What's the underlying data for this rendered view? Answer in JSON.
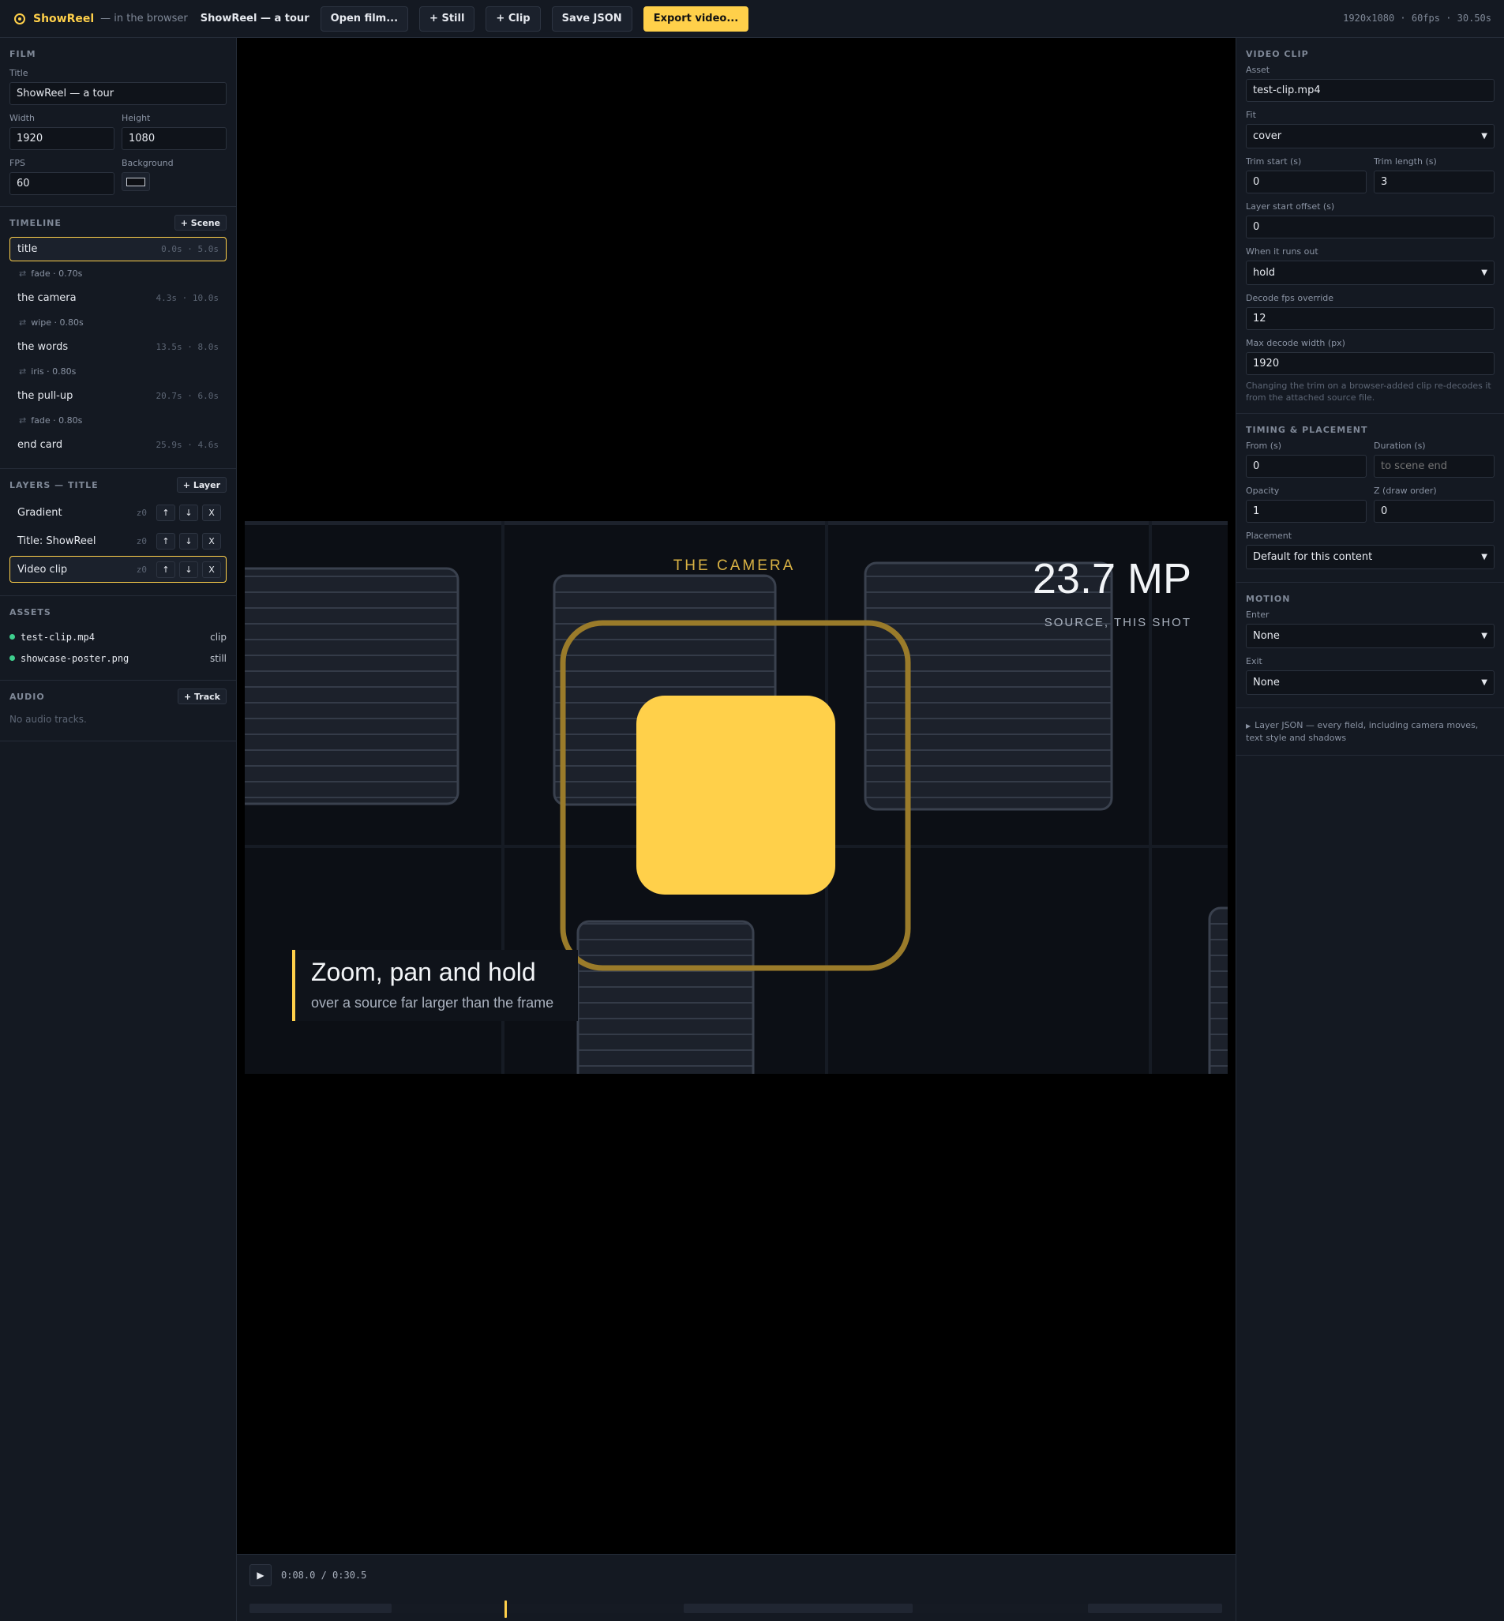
{
  "topbar": {
    "brand": "ShowReel",
    "brand_sub": "— in the browser",
    "film_name": "ShowReel — a tour",
    "buttons": {
      "open_film": "Open film...",
      "add_still": "+ Still",
      "add_clip": "+ Clip",
      "save_json": "Save JSON",
      "export_video": "Export video..."
    },
    "stats": "1920x1080 · 60fps · 30.50s",
    "accent_color": "#ffd04a"
  },
  "film": {
    "section_title": "FILM",
    "title_label": "Title",
    "title_value": "ShowReel — a tour",
    "width_label": "Width",
    "width_value": "1920",
    "height_label": "Height",
    "height_value": "1080",
    "fps_label": "FPS",
    "fps_value": "60",
    "background_label": "Background"
  },
  "timeline": {
    "section_title": "TIMELINE",
    "add_button": "+ Scene",
    "scenes": [
      {
        "name": "title",
        "time": "0.0s · 5.0s",
        "transition": "fade · 0.70s",
        "active": true
      },
      {
        "name": "the camera",
        "time": "4.3s · 10.0s",
        "transition": "wipe · 0.80s"
      },
      {
        "name": "the words",
        "time": "13.5s · 8.0s",
        "transition": "iris · 0.80s"
      },
      {
        "name": "the pull-up",
        "time": "20.7s · 6.0s",
        "transition": "fade · 0.80s"
      },
      {
        "name": "end card",
        "time": "25.9s · 4.6s"
      }
    ]
  },
  "layers": {
    "section_title": "LAYERS — TITLE",
    "add_button": "+ Layer",
    "items": [
      {
        "name": "Gradient",
        "z": "z0"
      },
      {
        "name": "Title: ShowReel",
        "z": "z0"
      },
      {
        "name": "Video clip",
        "z": "z0",
        "active": true
      }
    ],
    "up": "↑",
    "down": "↓",
    "delete": "X"
  },
  "assets": {
    "section_title": "ASSETS",
    "items": [
      {
        "name": "test-clip.mp4",
        "kind": "clip"
      },
      {
        "name": "showcase-poster.png",
        "kind": "still"
      }
    ]
  },
  "audio": {
    "section_title": "AUDIO",
    "add_button": "+ Track",
    "empty_text": "No audio tracks."
  },
  "stage": {
    "eyebrow": "THE CAMERA",
    "big_stat": "23.7 MP",
    "stat_caption": "SOURCE, THIS SHOT",
    "caption_title": "Zoom, pan and hold",
    "caption_sub": "over a source far larger than the frame"
  },
  "transport": {
    "play_icon": "▶",
    "time": "0:08.0 / 0:30.5",
    "playhead_fraction": 0.262
  },
  "inspector": {
    "video_clip": {
      "section_title": "VIDEO CLIP",
      "asset_label": "Asset",
      "asset_value": "test-clip.mp4",
      "fit_label": "Fit",
      "fit_value": "cover",
      "trim_start_label": "Trim start (s)",
      "trim_start_value": "0",
      "trim_length_label": "Trim length (s)",
      "trim_length_value": "3",
      "layer_offset_label": "Layer start offset (s)",
      "layer_offset_value": "0",
      "runs_out_label": "When it runs out",
      "runs_out_value": "hold",
      "decode_fps_label": "Decode fps override",
      "decode_fps_value": "12",
      "max_width_label": "Max decode width (px)",
      "max_width_value": "1920",
      "hint": "Changing the trim on a browser-added clip re-decodes it from the attached source file."
    },
    "timing": {
      "section_title": "TIMING & PLACEMENT",
      "from_label": "From (s)",
      "from_value": "0",
      "duration_label": "Duration (s)",
      "duration_placeholder": "to scene end",
      "opacity_label": "Opacity",
      "opacity_value": "1",
      "z_label": "Z (draw order)",
      "z_value": "0",
      "placement_label": "Placement",
      "placement_value": "Default for this content"
    },
    "motion": {
      "section_title": "MOTION",
      "enter_label": "Enter",
      "enter_value": "None",
      "exit_label": "Exit",
      "exit_value": "None"
    },
    "layer_json": "Layer JSON — every field, including camera moves, text style and shadows"
  }
}
